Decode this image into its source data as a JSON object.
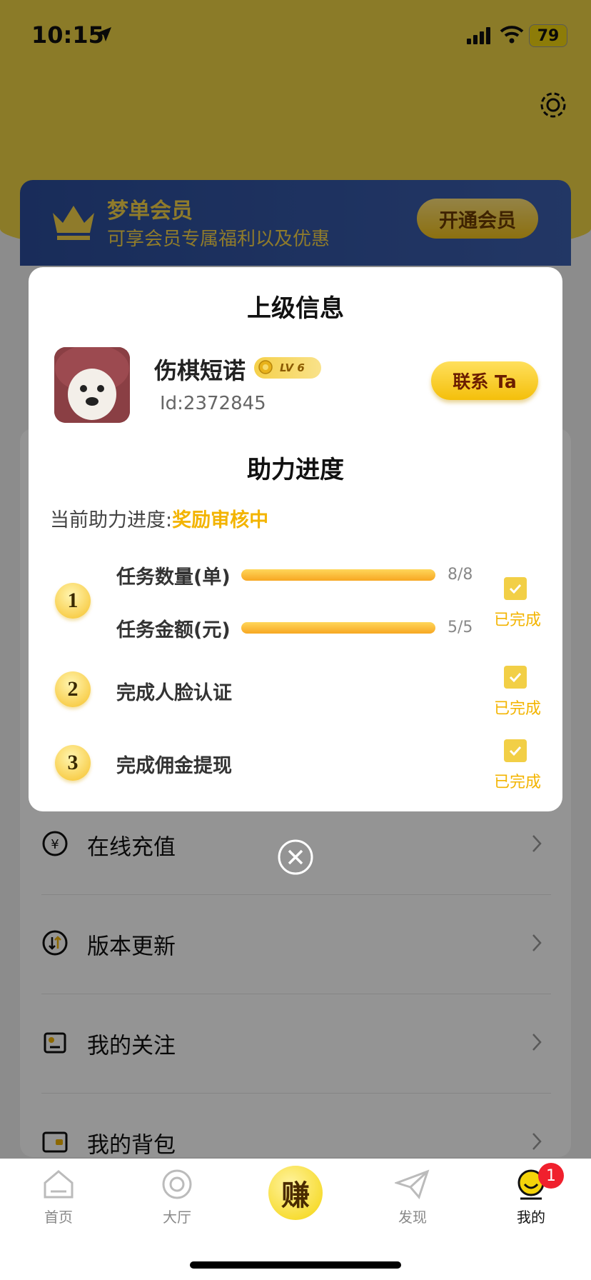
{
  "status_bar": {
    "time": "10:15",
    "battery": "79"
  },
  "member_banner": {
    "title": "梦单会员",
    "subtitle": "可享会员专属福利以及优惠",
    "button": "开通会员"
  },
  "menu": {
    "items": [
      {
        "label": "在线充值",
        "icon": "yuan-coin-icon"
      },
      {
        "label": "版本更新",
        "icon": "update-icon"
      },
      {
        "label": "我的关注",
        "icon": "follow-icon"
      },
      {
        "label": "我的背包",
        "icon": "wallet-icon"
      }
    ]
  },
  "tabbar": {
    "tabs": [
      {
        "label": "首页",
        "icon": "home-icon"
      },
      {
        "label": "大厅",
        "icon": "hall-icon"
      },
      {
        "label": "赚",
        "icon": "earn-icon"
      },
      {
        "label": "发现",
        "icon": "paper-plane-icon"
      },
      {
        "label": "我的",
        "icon": "smiley-icon"
      }
    ],
    "badge": "1"
  },
  "modal": {
    "title": "上级信息",
    "user": {
      "name": "伤棋短诺",
      "level": "LV 6",
      "id": "Id:2372845"
    },
    "contact_button": "联系 Ta",
    "progress_title": "助力进度",
    "current_label": "当前助力进度:",
    "current_status": "奖励审核中",
    "steps": [
      {
        "number": "1",
        "tasks": [
          {
            "label": "任务数量(单)",
            "value": "8/8",
            "progress": 1.0
          },
          {
            "label": "任务金额(元)",
            "value": "5/5",
            "progress": 1.0
          }
        ],
        "status": "已完成"
      },
      {
        "number": "2",
        "label": "完成人脸认证",
        "status": "已完成"
      },
      {
        "number": "3",
        "label": "完成佣金提现",
        "status": "已完成"
      }
    ]
  },
  "colors": {
    "accent_yellow": "#f3b400",
    "header_yellow": "#efd445",
    "banner_blue": "#2b4d9b"
  }
}
